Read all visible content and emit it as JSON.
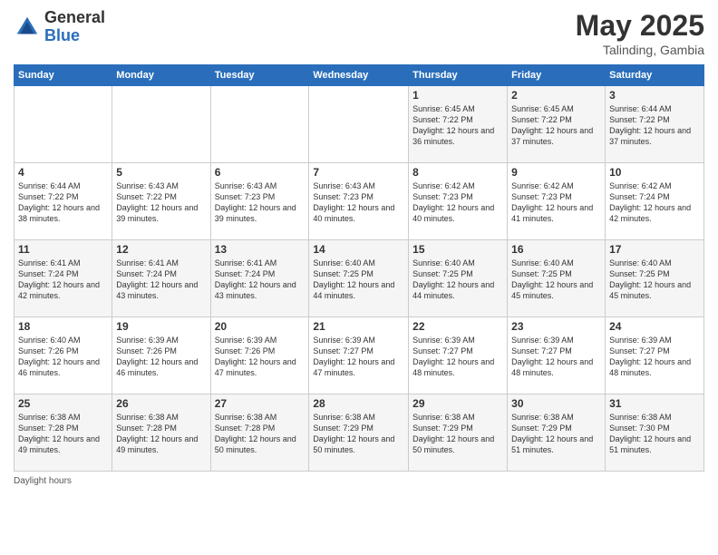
{
  "header": {
    "logo_general": "General",
    "logo_blue": "Blue",
    "title": "May 2025",
    "location": "Talinding, Gambia"
  },
  "days_of_week": [
    "Sunday",
    "Monday",
    "Tuesday",
    "Wednesday",
    "Thursday",
    "Friday",
    "Saturday"
  ],
  "footer": {
    "note": "Daylight hours"
  },
  "weeks": [
    [
      {
        "date": "",
        "sunrise": "",
        "sunset": "",
        "daylight": ""
      },
      {
        "date": "",
        "sunrise": "",
        "sunset": "",
        "daylight": ""
      },
      {
        "date": "",
        "sunrise": "",
        "sunset": "",
        "daylight": ""
      },
      {
        "date": "",
        "sunrise": "",
        "sunset": "",
        "daylight": ""
      },
      {
        "date": "1",
        "sunrise": "6:45 AM",
        "sunset": "7:22 PM",
        "daylight": "12 hours and 36 minutes."
      },
      {
        "date": "2",
        "sunrise": "6:45 AM",
        "sunset": "7:22 PM",
        "daylight": "12 hours and 37 minutes."
      },
      {
        "date": "3",
        "sunrise": "6:44 AM",
        "sunset": "7:22 PM",
        "daylight": "12 hours and 37 minutes."
      }
    ],
    [
      {
        "date": "4",
        "sunrise": "6:44 AM",
        "sunset": "7:22 PM",
        "daylight": "12 hours and 38 minutes."
      },
      {
        "date": "5",
        "sunrise": "6:43 AM",
        "sunset": "7:22 PM",
        "daylight": "12 hours and 39 minutes."
      },
      {
        "date": "6",
        "sunrise": "6:43 AM",
        "sunset": "7:23 PM",
        "daylight": "12 hours and 39 minutes."
      },
      {
        "date": "7",
        "sunrise": "6:43 AM",
        "sunset": "7:23 PM",
        "daylight": "12 hours and 40 minutes."
      },
      {
        "date": "8",
        "sunrise": "6:42 AM",
        "sunset": "7:23 PM",
        "daylight": "12 hours and 40 minutes."
      },
      {
        "date": "9",
        "sunrise": "6:42 AM",
        "sunset": "7:23 PM",
        "daylight": "12 hours and 41 minutes."
      },
      {
        "date": "10",
        "sunrise": "6:42 AM",
        "sunset": "7:24 PM",
        "daylight": "12 hours and 42 minutes."
      }
    ],
    [
      {
        "date": "11",
        "sunrise": "6:41 AM",
        "sunset": "7:24 PM",
        "daylight": "12 hours and 42 minutes."
      },
      {
        "date": "12",
        "sunrise": "6:41 AM",
        "sunset": "7:24 PM",
        "daylight": "12 hours and 43 minutes."
      },
      {
        "date": "13",
        "sunrise": "6:41 AM",
        "sunset": "7:24 PM",
        "daylight": "12 hours and 43 minutes."
      },
      {
        "date": "14",
        "sunrise": "6:40 AM",
        "sunset": "7:25 PM",
        "daylight": "12 hours and 44 minutes."
      },
      {
        "date": "15",
        "sunrise": "6:40 AM",
        "sunset": "7:25 PM",
        "daylight": "12 hours and 44 minutes."
      },
      {
        "date": "16",
        "sunrise": "6:40 AM",
        "sunset": "7:25 PM",
        "daylight": "12 hours and 45 minutes."
      },
      {
        "date": "17",
        "sunrise": "6:40 AM",
        "sunset": "7:25 PM",
        "daylight": "12 hours and 45 minutes."
      }
    ],
    [
      {
        "date": "18",
        "sunrise": "6:40 AM",
        "sunset": "7:26 PM",
        "daylight": "12 hours and 46 minutes."
      },
      {
        "date": "19",
        "sunrise": "6:39 AM",
        "sunset": "7:26 PM",
        "daylight": "12 hours and 46 minutes."
      },
      {
        "date": "20",
        "sunrise": "6:39 AM",
        "sunset": "7:26 PM",
        "daylight": "12 hours and 47 minutes."
      },
      {
        "date": "21",
        "sunrise": "6:39 AM",
        "sunset": "7:27 PM",
        "daylight": "12 hours and 47 minutes."
      },
      {
        "date": "22",
        "sunrise": "6:39 AM",
        "sunset": "7:27 PM",
        "daylight": "12 hours and 48 minutes."
      },
      {
        "date": "23",
        "sunrise": "6:39 AM",
        "sunset": "7:27 PM",
        "daylight": "12 hours and 48 minutes."
      },
      {
        "date": "24",
        "sunrise": "6:39 AM",
        "sunset": "7:27 PM",
        "daylight": "12 hours and 48 minutes."
      }
    ],
    [
      {
        "date": "25",
        "sunrise": "6:38 AM",
        "sunset": "7:28 PM",
        "daylight": "12 hours and 49 minutes."
      },
      {
        "date": "26",
        "sunrise": "6:38 AM",
        "sunset": "7:28 PM",
        "daylight": "12 hours and 49 minutes."
      },
      {
        "date": "27",
        "sunrise": "6:38 AM",
        "sunset": "7:28 PM",
        "daylight": "12 hours and 50 minutes."
      },
      {
        "date": "28",
        "sunrise": "6:38 AM",
        "sunset": "7:29 PM",
        "daylight": "12 hours and 50 minutes."
      },
      {
        "date": "29",
        "sunrise": "6:38 AM",
        "sunset": "7:29 PM",
        "daylight": "12 hours and 50 minutes."
      },
      {
        "date": "30",
        "sunrise": "6:38 AM",
        "sunset": "7:29 PM",
        "daylight": "12 hours and 51 minutes."
      },
      {
        "date": "31",
        "sunrise": "6:38 AM",
        "sunset": "7:30 PM",
        "daylight": "12 hours and 51 minutes."
      }
    ]
  ]
}
